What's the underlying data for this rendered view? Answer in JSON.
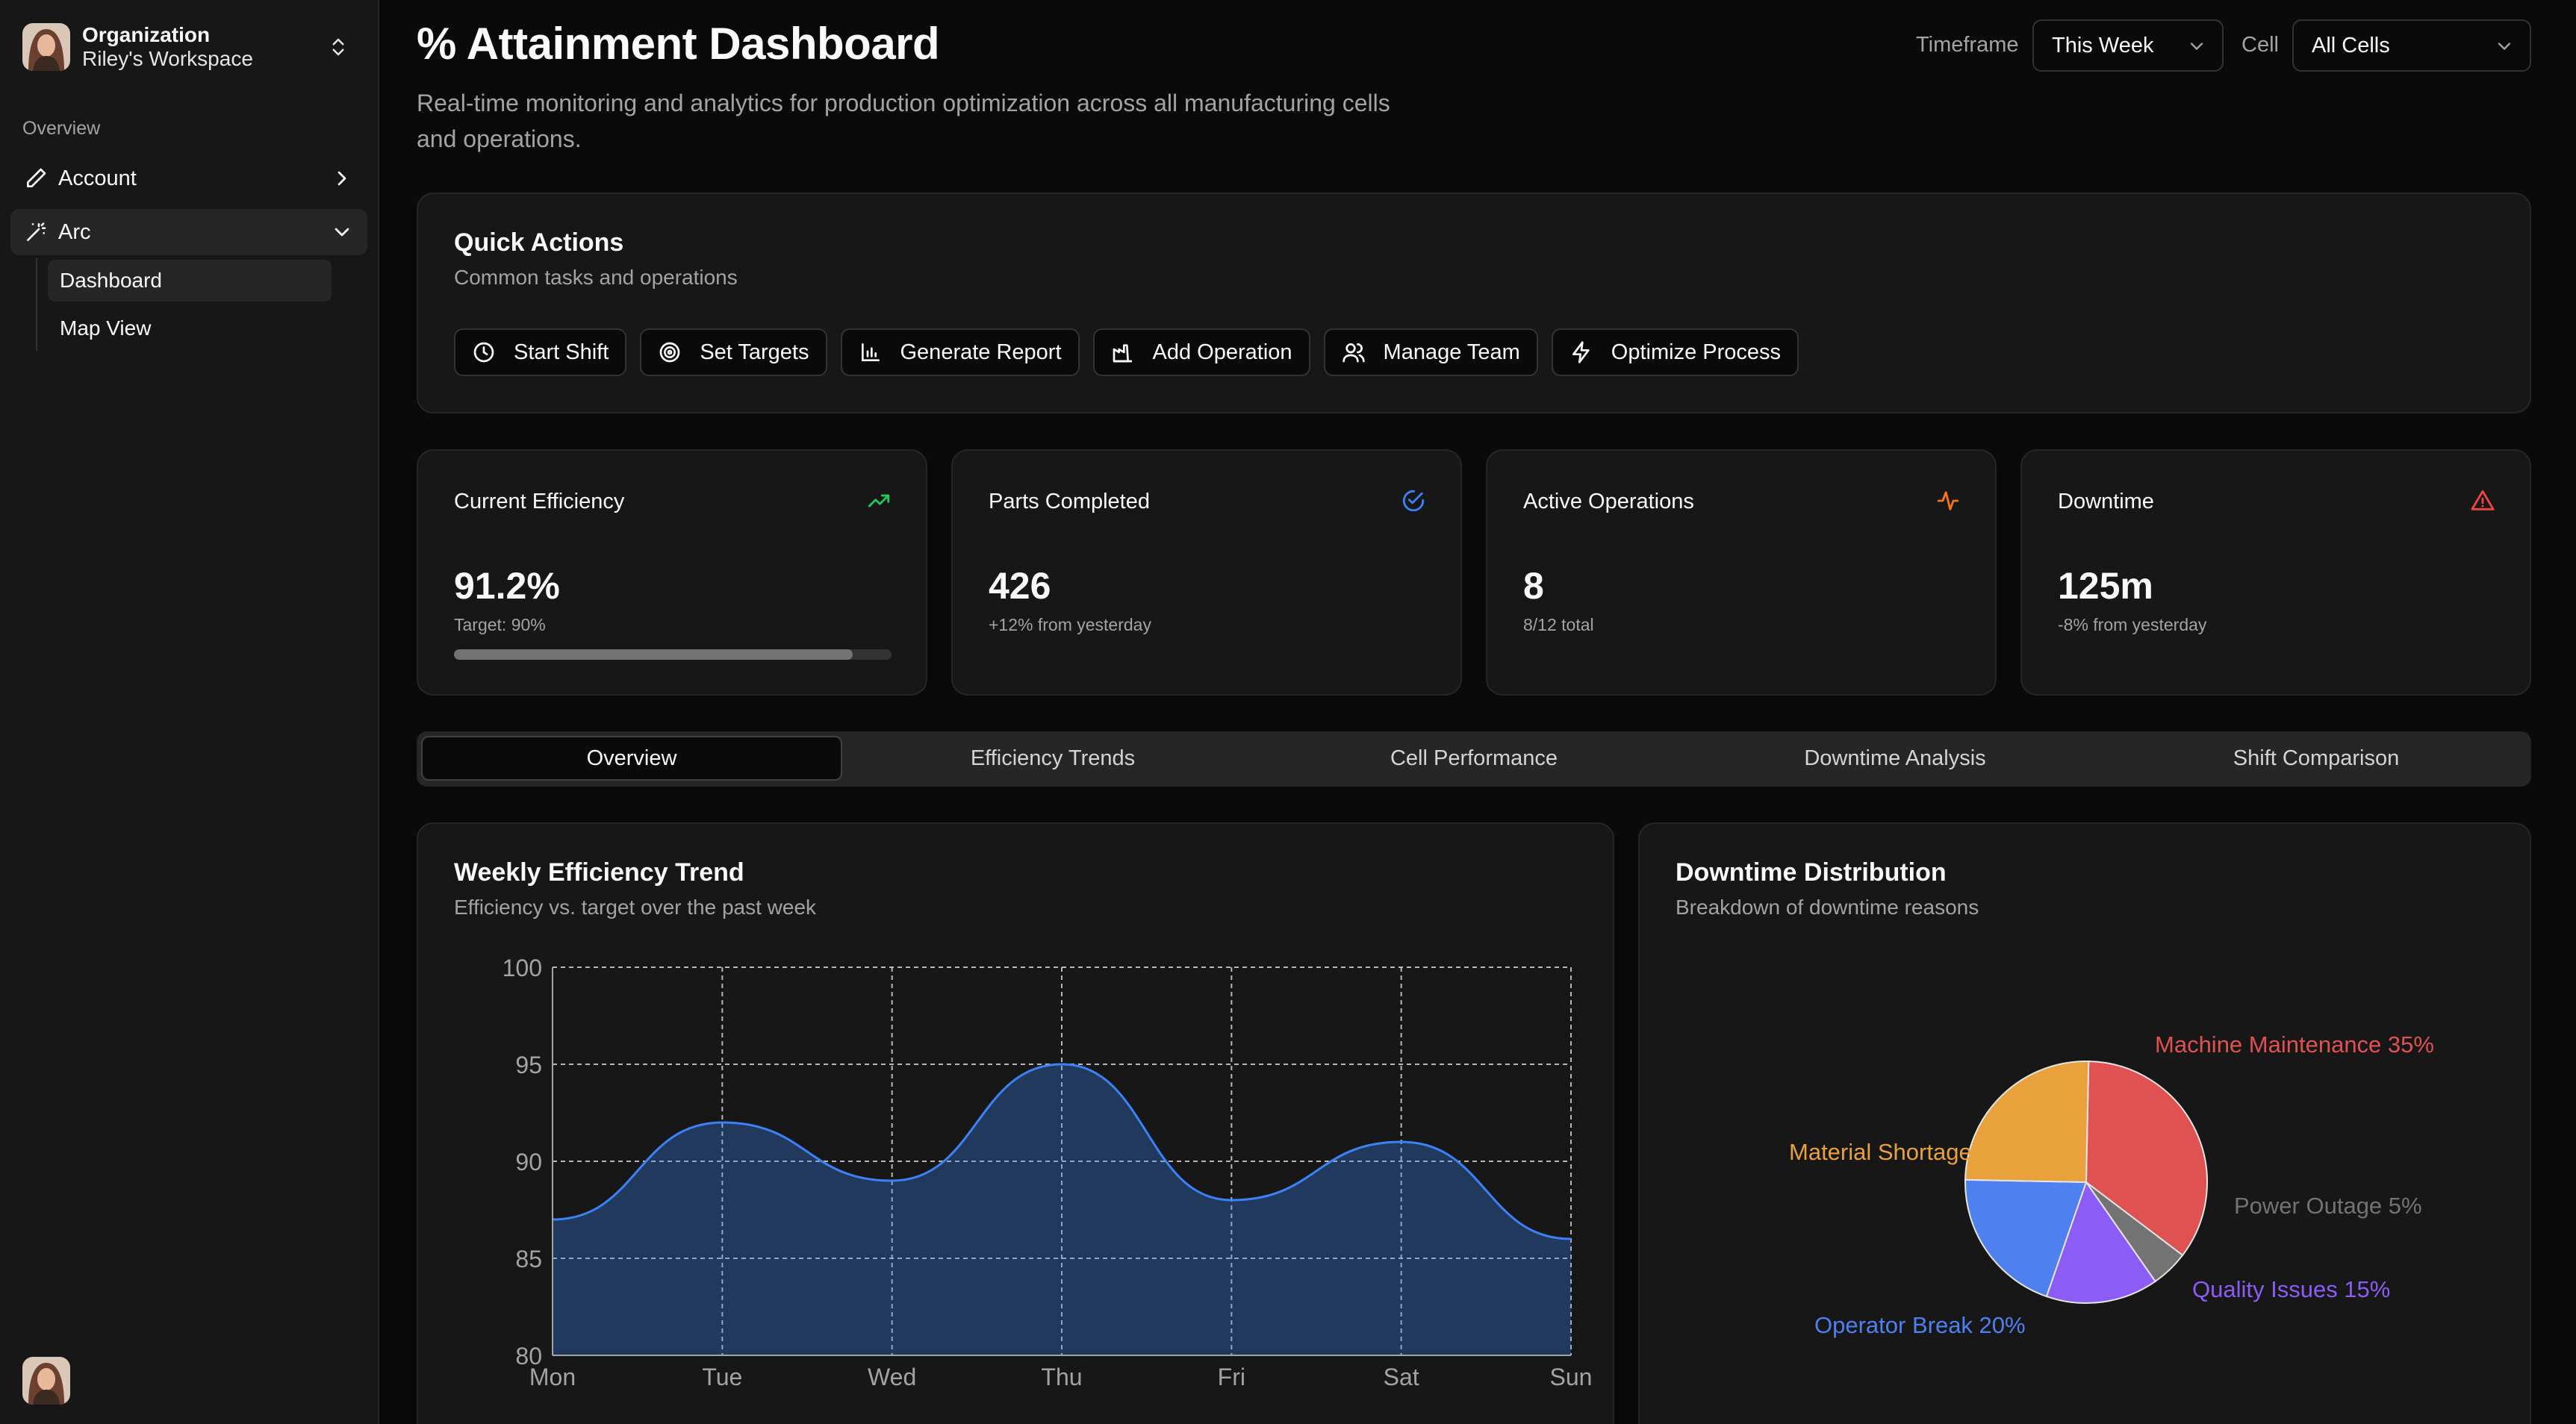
{
  "sidebar": {
    "org_name": "Organization",
    "org_workspace": "Riley's Workspace",
    "section": "Overview",
    "items": [
      {
        "label": "Account",
        "icon": "pencil-icon"
      },
      {
        "label": "Arc",
        "icon": "wand-icon",
        "children": [
          "Dashboard",
          "Map View"
        ]
      }
    ]
  },
  "header": {
    "title": "% Attainment Dashboard",
    "description": "Real-time monitoring and analytics for production optimization across all manufacturing cells and operations.",
    "timeframe_label": "Timeframe",
    "timeframe_value": "This Week",
    "cell_label": "Cell",
    "cell_value": "All Cells"
  },
  "quick_actions": {
    "title": "Quick Actions",
    "subtitle": "Common tasks and operations",
    "buttons": [
      "Start Shift",
      "Set Targets",
      "Generate Report",
      "Add Operation",
      "Manage Team",
      "Optimize Process"
    ]
  },
  "stats": [
    {
      "title": "Current Efficiency",
      "value": "91.2%",
      "note": "Target: 90%",
      "icon": "trending-up-icon",
      "color": "#22c55e",
      "progress": 0.912
    },
    {
      "title": "Parts Completed",
      "value": "426",
      "note": "+12% from yesterday",
      "icon": "check-circle-icon",
      "color": "#3b82f6"
    },
    {
      "title": "Active Operations",
      "value": "8",
      "note": "8/12 total",
      "icon": "activity-icon",
      "color": "#f97316"
    },
    {
      "title": "Downtime",
      "value": "125m",
      "note": "-8% from yesterday",
      "icon": "alert-triangle-icon",
      "color": "#ef4444"
    }
  ],
  "tabs": [
    "Overview",
    "Efficiency Trends",
    "Cell Performance",
    "Downtime Analysis",
    "Shift Comparison"
  ],
  "trend_card": {
    "title": "Weekly Efficiency Trend",
    "subtitle": "Efficiency vs. target over the past week"
  },
  "pie_card": {
    "title": "Downtime Distribution",
    "subtitle": "Breakdown of downtime reasons"
  },
  "chart_data": [
    {
      "type": "area",
      "title": "Weekly Efficiency Trend",
      "categories": [
        "Mon",
        "Tue",
        "Wed",
        "Thu",
        "Fri",
        "Sat",
        "Sun"
      ],
      "values": [
        87,
        92,
        89,
        95,
        88,
        91,
        86
      ],
      "ylim": [
        80,
        100
      ],
      "yticks": [
        80,
        85,
        90,
        95,
        100
      ],
      "grid": true,
      "color": "#3b82f6"
    },
    {
      "type": "pie",
      "title": "Downtime Distribution",
      "slices": [
        {
          "label": "Machine Maintenance",
          "value": 35,
          "color": "#e05252"
        },
        {
          "label": "Power Outage",
          "value": 5,
          "color": "#737373"
        },
        {
          "label": "Quality Issues",
          "value": 15,
          "color": "#8b5cf6"
        },
        {
          "label": "Operator Break",
          "value": 20,
          "color": "#4f80f0"
        },
        {
          "label": "Material Shortage",
          "value": 25,
          "color": "#e9a23b"
        }
      ]
    }
  ]
}
